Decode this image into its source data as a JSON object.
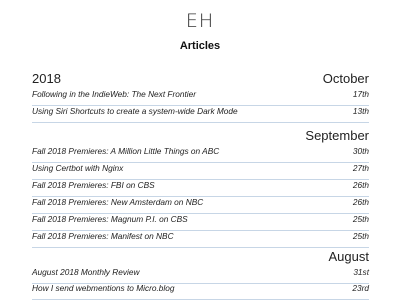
{
  "header": {
    "logo": "EH",
    "title": "Articles"
  },
  "archive": {
    "year": "2018",
    "months": [
      {
        "name": "October",
        "articles": [
          {
            "title": "Following in the IndieWeb: The Next Frontier",
            "day": "17th"
          },
          {
            "title": "Using Siri Shortcuts to create a system-wide Dark Mode",
            "day": "13th"
          }
        ]
      },
      {
        "name": "September",
        "articles": [
          {
            "title": "Fall 2018 Premieres: A Million Little Things on ABC",
            "day": "30th"
          },
          {
            "title": "Using Certbot with Nginx",
            "day": "27th"
          },
          {
            "title": "Fall 2018 Premieres: FBI on CBS",
            "day": "26th"
          },
          {
            "title": "Fall 2018 Premieres: New Amsterdam on NBC",
            "day": "26th"
          },
          {
            "title": "Fall 2018 Premieres: Magnum P.I. on CBS",
            "day": "25th"
          },
          {
            "title": "Fall 2018 Premieres: Manifest on NBC",
            "day": "25th"
          }
        ]
      },
      {
        "name": "August",
        "articles": [
          {
            "title": "August 2018 Monthly Review",
            "day": "31st"
          },
          {
            "title": "How I send webmentions to Micro.blog",
            "day": "23rd"
          }
        ]
      }
    ]
  },
  "colors": {
    "divider": "#c7d6e6",
    "text": "#222222"
  }
}
